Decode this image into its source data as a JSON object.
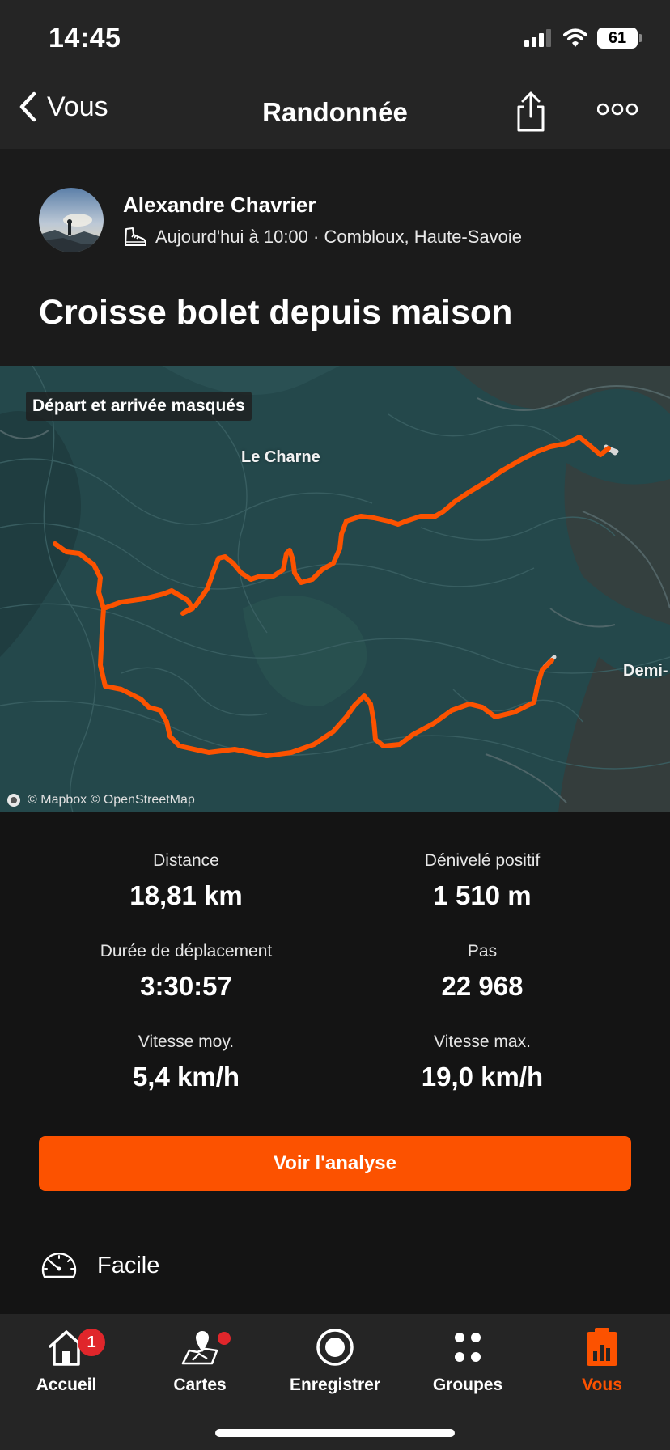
{
  "status_bar": {
    "time": "14:45",
    "battery": "61"
  },
  "nav": {
    "back_label": "Vous",
    "title": "Randonnée"
  },
  "activity": {
    "athlete_name": "Alexandre Chavrier",
    "meta": "Aujourd'hui à 10:00 · Combloux, Haute-Savoie",
    "title": "Croisse bolet depuis maison"
  },
  "map": {
    "badge": "Départ et arrivée masqués",
    "place_labels": [
      "Le Charne",
      "Demi-"
    ],
    "attribution": "© Mapbox © OpenStreetMap",
    "route_color": "#fc5200"
  },
  "stats": [
    {
      "label": "Distance",
      "value": "18,81 km"
    },
    {
      "label": "Dénivelé positif",
      "value": "1 510 m"
    },
    {
      "label": "Durée de déplacement",
      "value": "3:30:57"
    },
    {
      "label": "Pas",
      "value": "22 968"
    },
    {
      "label": "Vitesse moy.",
      "value": "5,4 km/h"
    },
    {
      "label": "Vitesse max.",
      "value": "19,0 km/h"
    }
  ],
  "cta_label": "Voir l'analyse",
  "difficulty": "Facile",
  "tabs": [
    {
      "label": "Accueil",
      "icon": "home-icon",
      "badge": "1"
    },
    {
      "label": "Cartes",
      "icon": "maps-icon"
    },
    {
      "label": "Enregistrer",
      "icon": "record-icon"
    },
    {
      "label": "Groupes",
      "icon": "groups-icon"
    },
    {
      "label": "Vous",
      "icon": "you-icon",
      "active": true
    }
  ],
  "colors": {
    "accent": "#fc5200",
    "badge": "#e0262b",
    "background": "#141414",
    "bar": "#252525"
  }
}
